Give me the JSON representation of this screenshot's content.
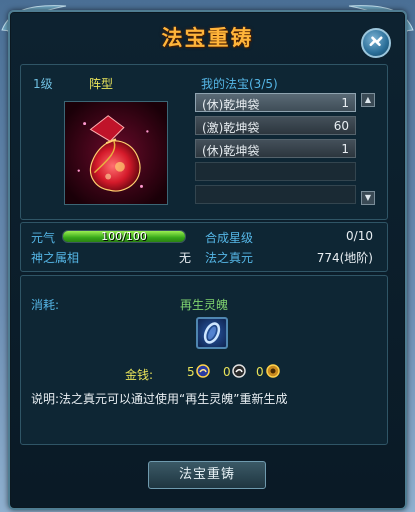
{
  "window": {
    "title": "法宝重铸"
  },
  "treasure": {
    "level": "1级",
    "formation": "阵型"
  },
  "my_treasures": {
    "title": "我的法宝(3/5)",
    "items": [
      {
        "name": "(休)乾坤袋",
        "count": "1",
        "selected": true
      },
      {
        "name": "(激)乾坤袋",
        "count": "60",
        "selected": false
      },
      {
        "name": "(休)乾坤袋",
        "count": "1",
        "selected": false
      },
      {
        "name": "",
        "count": "",
        "selected": false
      },
      {
        "name": "",
        "count": "",
        "selected": false
      }
    ]
  },
  "stats": {
    "yuanqi_label": "元气",
    "yuanqi_value": "100/100",
    "yuanqi_fraction": 1.0,
    "element_label": "神之属相",
    "element_value": "无",
    "star_label": "合成星级",
    "star_value": "0/10",
    "essence_label": "法之真元",
    "essence_value": "774(地阶)"
  },
  "cost": {
    "label": "消耗:",
    "item_name": "再生灵魄",
    "money_label": "金钱:",
    "gold": "5",
    "silver": "0",
    "copper": "0"
  },
  "description": "说明:法之真元可以通过使用“再生灵魄”重新生成",
  "action_button": "法宝重铸",
  "colors": {
    "title": "#ffb43a",
    "accent_blue": "#55b6e6",
    "accent_yellow": "#e8e35a",
    "bar_green": "#37a81a"
  }
}
